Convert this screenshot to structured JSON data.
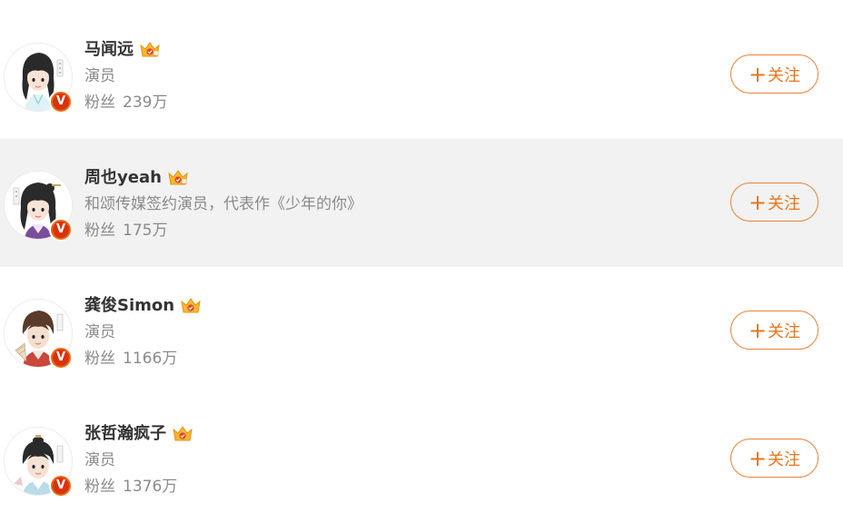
{
  "users": [
    {
      "name": "马闻远",
      "description": "演员",
      "fans_label": "粉丝",
      "fans_count": "239万",
      "follow_label": "关注",
      "follow_plus": "+",
      "badge": "V",
      "highlighted": false,
      "crown_icon": "crown-icon"
    },
    {
      "name": "周也yeah",
      "description": "和颂传媒签约演员，代表作《少年的你》",
      "fans_label": "粉丝",
      "fans_count": "175万",
      "follow_label": "关注",
      "follow_plus": "+",
      "badge": "V",
      "highlighted": true,
      "crown_icon": "crown-icon"
    },
    {
      "name": "龚俊Simon",
      "description": "演员",
      "fans_label": "粉丝",
      "fans_count": "1166万",
      "follow_label": "关注",
      "follow_plus": "+",
      "badge": "V",
      "highlighted": false,
      "crown_icon": "crown-icon"
    },
    {
      "name": "张哲瀚疯子",
      "description": "演员",
      "fans_label": "粉丝",
      "fans_count": "1376万",
      "follow_label": "关注",
      "follow_plus": "+",
      "badge": "V",
      "highlighted": false,
      "crown_icon": "crown-icon"
    }
  ],
  "colors": {
    "accent": "#e8741e",
    "badge": "#d9320e",
    "highlight_bg": "#f2f2f2",
    "name": "#333333",
    "meta": "#8a8a8a"
  }
}
